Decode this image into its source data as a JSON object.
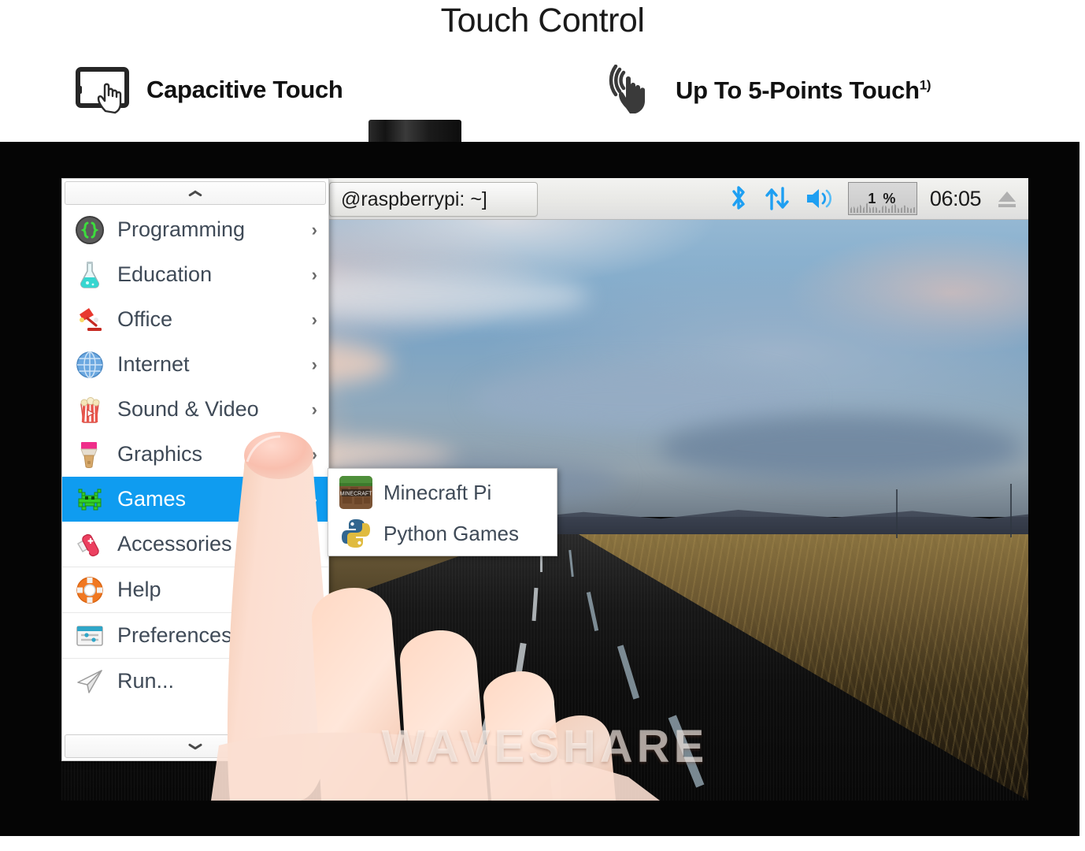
{
  "header": {
    "title": "Touch Control",
    "features": [
      {
        "icon": "tablet-touch-icon",
        "label": "Capacitive Touch",
        "sup": ""
      },
      {
        "icon": "five-point-tap-icon",
        "label": "Up To 5-Points Touch",
        "sup": "1)"
      }
    ]
  },
  "taskbar": {
    "window_button_label": "@raspberrypi: ~]",
    "tray": {
      "bluetooth_icon": "bluetooth-icon",
      "network_icon": "network-updown-icon",
      "volume_icon": "volume-icon",
      "cpu_label": "1 %",
      "clock": "06:05",
      "eject_icon": "eject-icon"
    },
    "colors": {
      "accent_blue": "#1e9ff2",
      "tray_gray": "#9a9a9a"
    }
  },
  "menu": {
    "scroll_up_icon": "chevron-up-icon",
    "scroll_down_icon": "chevron-down-icon",
    "highlight_color": "#0f9cf0",
    "items": [
      {
        "label": "Programming",
        "icon": "code-braces-icon",
        "arrow": "›",
        "selected": false,
        "separator": false
      },
      {
        "label": "Education",
        "icon": "flask-icon",
        "arrow": "›",
        "selected": false,
        "separator": false
      },
      {
        "label": "Office",
        "icon": "desk-lamp-icon",
        "arrow": "›",
        "selected": false,
        "separator": false
      },
      {
        "label": "Internet",
        "icon": "globe-icon",
        "arrow": "›",
        "selected": false,
        "separator": false
      },
      {
        "label": "Sound & Video",
        "icon": "popcorn-play-icon",
        "arrow": "›",
        "selected": false,
        "separator": false
      },
      {
        "label": "Graphics",
        "icon": "paintbrush-icon",
        "arrow": "›",
        "selected": false,
        "separator": false
      },
      {
        "label": "Games",
        "icon": "space-invader-icon",
        "arrow": "›",
        "selected": true,
        "separator": false
      },
      {
        "label": "Accessories",
        "icon": "swiss-knife-icon",
        "arrow": "",
        "selected": false,
        "separator": false
      },
      {
        "label": "Help",
        "icon": "lifebuoy-icon",
        "arrow": "",
        "selected": false,
        "separator": true
      },
      {
        "label": "Preferences",
        "icon": "settings-window-icon",
        "arrow": "",
        "selected": false,
        "separator": true
      },
      {
        "label": "Run...",
        "icon": "paper-plane-icon",
        "arrow": "",
        "selected": false,
        "separator": true
      }
    ]
  },
  "submenu": {
    "parent": "Games",
    "items": [
      {
        "label": "Minecraft Pi",
        "icon": "minecraft-icon"
      },
      {
        "label": "Python Games",
        "icon": "python-icon"
      }
    ]
  },
  "watermark": "WAVESHARE"
}
